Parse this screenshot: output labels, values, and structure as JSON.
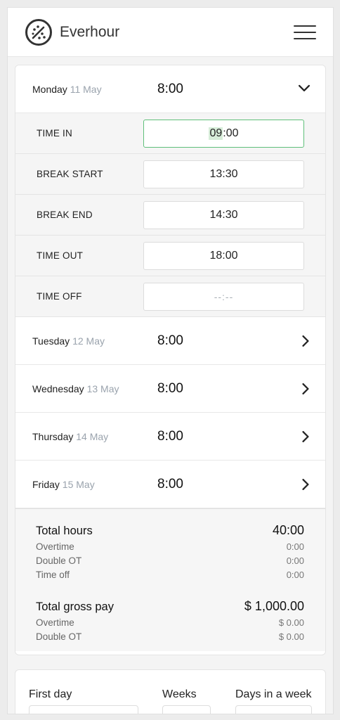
{
  "app": {
    "name": "Everhour"
  },
  "expanded_day": {
    "label": "Monday",
    "date": "11 May",
    "hours": "8:00",
    "fields": [
      {
        "label": "TIME IN",
        "value": "09:00",
        "focused": true
      },
      {
        "label": "BREAK START",
        "value": "13:30"
      },
      {
        "label": "BREAK END",
        "value": "14:30"
      },
      {
        "label": "TIME OUT",
        "value": "18:00"
      },
      {
        "label": "TIME OFF",
        "placeholder": "--:--"
      }
    ]
  },
  "days": [
    {
      "label": "Tuesday",
      "date": "12 May",
      "hours": "8:00"
    },
    {
      "label": "Wednesday",
      "date": "13 May",
      "hours": "8:00"
    },
    {
      "label": "Thursday",
      "date": "14 May",
      "hours": "8:00"
    },
    {
      "label": "Friday",
      "date": "15 May",
      "hours": "8:00"
    }
  ],
  "totals": {
    "hours": {
      "label": "Total hours",
      "value": "40:00"
    },
    "hours_breakdown": [
      {
        "label": "Overtime",
        "value": "0:00"
      },
      {
        "label": "Double OT",
        "value": "0:00"
      },
      {
        "label": "Time off",
        "value": "0:00"
      }
    ],
    "pay": {
      "label": "Total gross pay",
      "value": "$ 1,000.00"
    },
    "pay_breakdown": [
      {
        "label": "Overtime",
        "value": "$ 0.00"
      },
      {
        "label": "Double OT",
        "value": "$ 0.00"
      }
    ]
  },
  "settings": {
    "first_day_label": "First day",
    "weeks_label": "Weeks",
    "days_in_week_label": "Days in a week"
  },
  "colors": {
    "focus_border": "#5fbf7a",
    "date_gray": "#9aa3ad"
  }
}
